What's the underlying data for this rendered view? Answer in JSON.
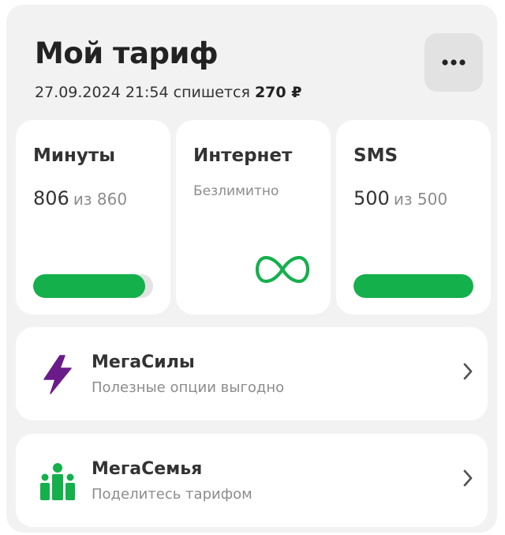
{
  "tariff": {
    "title": "Мой тариф",
    "charge_date": "27.09.2024 21:54",
    "charge_text": "спишется",
    "charge_amount": "270 ₽"
  },
  "colors": {
    "accent_green": "#14b04b",
    "megasily_purple": "#6a1b8a"
  },
  "cards": {
    "minutes": {
      "title": "Минуты",
      "value": "806",
      "of_text": "из 860",
      "progress": 0.937
    },
    "internet": {
      "title": "Интернет",
      "status": "Безлимитно",
      "icon": "infinity-icon"
    },
    "sms": {
      "title": "SMS",
      "value": "500",
      "of_text": "из 500",
      "progress": 1.0
    }
  },
  "services": [
    {
      "title": "МегаСилы",
      "subtitle": "Полезные опции выгодно",
      "icon": "lightning-icon"
    },
    {
      "title": "МегаСемья",
      "subtitle": "Поделитесь тарифом",
      "icon": "family-icon"
    }
  ]
}
